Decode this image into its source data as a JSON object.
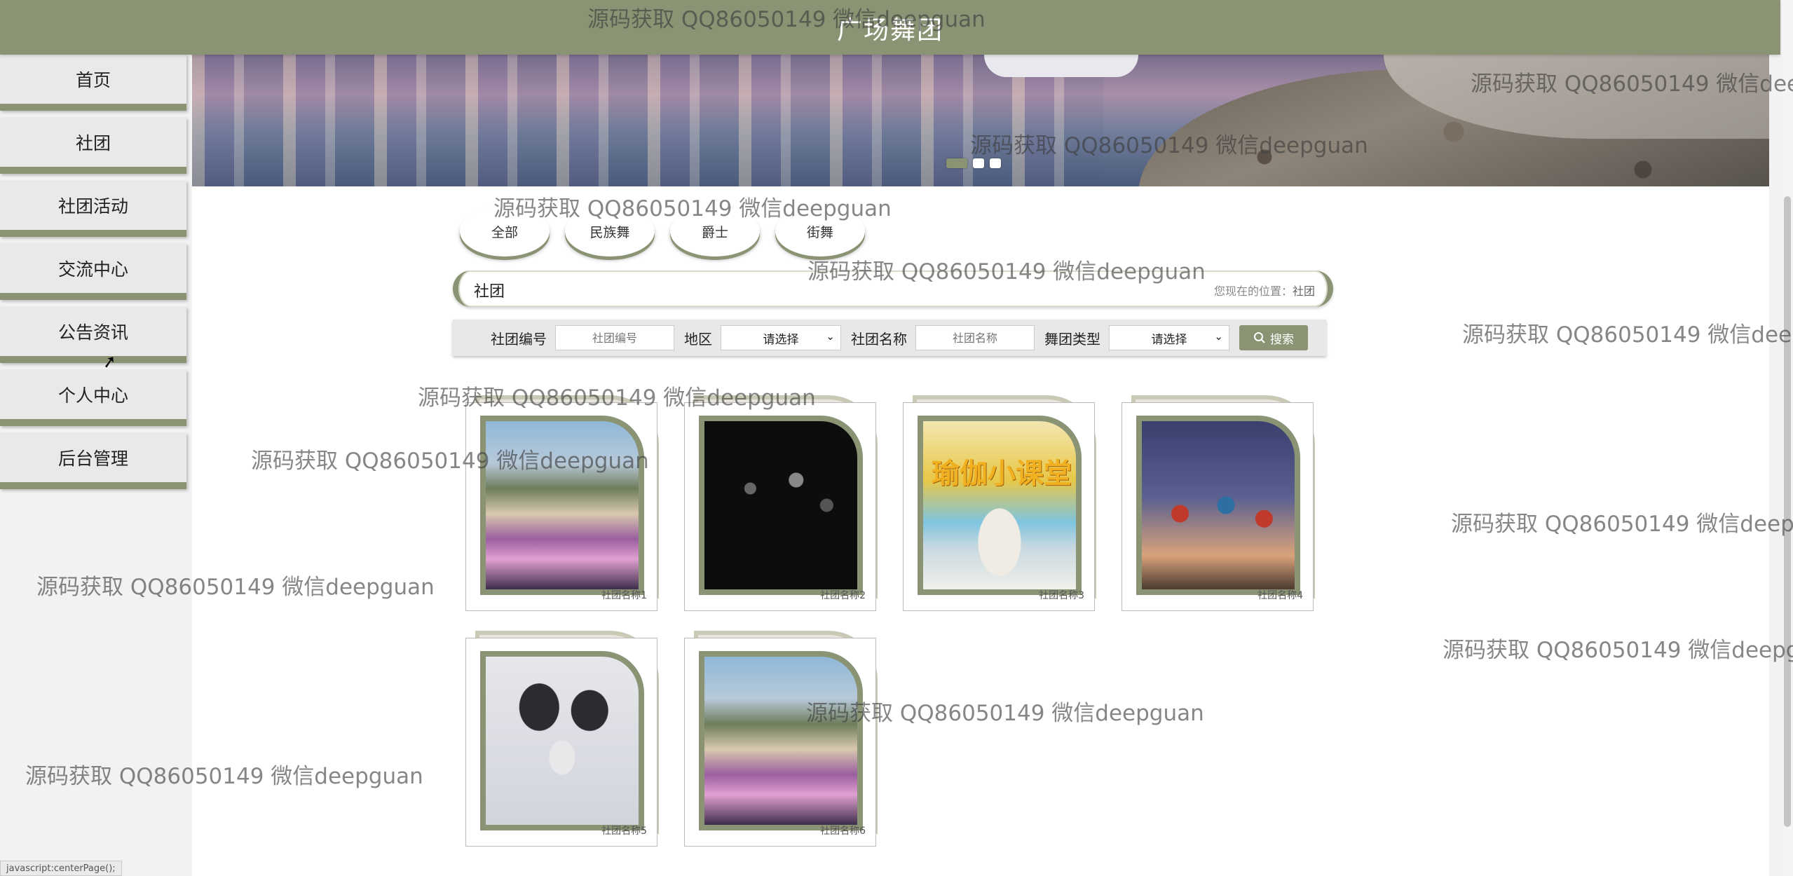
{
  "site_title": "广场舞团",
  "nav": {
    "items": [
      {
        "label": "首页"
      },
      {
        "label": "社团"
      },
      {
        "label": "社团活动"
      },
      {
        "label": "交流中心"
      },
      {
        "label": "公告资讯"
      },
      {
        "label": "个人中心"
      },
      {
        "label": "后台管理"
      }
    ]
  },
  "banner": {
    "slide_count": 3,
    "active_slide": 1
  },
  "tabs": [
    {
      "label": "全部"
    },
    {
      "label": "民族舞"
    },
    {
      "label": "爵士"
    },
    {
      "label": "街舞"
    }
  ],
  "breadcrumb": {
    "title": "社团",
    "location_prefix": "您现在的位置：",
    "location_current": "社团"
  },
  "filters": {
    "club_id_label": "社团编号",
    "club_id_placeholder": "社团编号",
    "region_label": "地区",
    "region_value": "请选择",
    "club_name_label": "社团名称",
    "club_name_placeholder": "社团名称",
    "dance_type_label": "舞团类型",
    "dance_type_value": "请选择",
    "search_label": "搜索"
  },
  "clubs": [
    {
      "name": "社团名称1"
    },
    {
      "name": "社团名称2"
    },
    {
      "name": "社团名称3",
      "image_caption": "瑜伽小课堂"
    },
    {
      "name": "社团名称4"
    },
    {
      "name": "社团名称5"
    },
    {
      "name": "社团名称6"
    }
  ],
  "watermark_text": "源码获取 QQ86050149 微信deepguan",
  "status_bar": "javascript:centerPage();",
  "colors": {
    "accent": "#8a9474",
    "page_bg": "#f2f2f2"
  }
}
